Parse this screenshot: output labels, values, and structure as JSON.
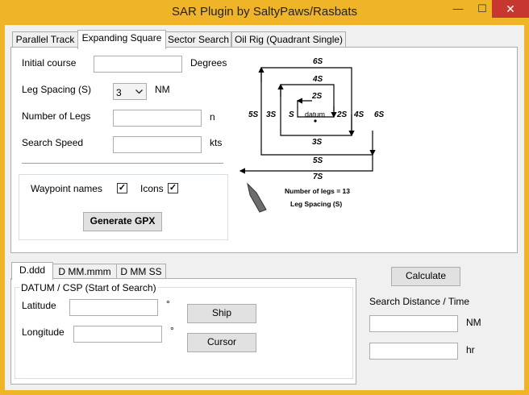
{
  "window": {
    "title": "SAR Plugin by SaltyPaws/Rasbats",
    "min_symbol": "—",
    "max_symbol": "☐",
    "close_symbol": "✕"
  },
  "tabs": [
    {
      "label": "Parallel Track"
    },
    {
      "label": "Expanding Square"
    },
    {
      "label": "Sector Search"
    },
    {
      "label": "Oil Rig (Quadrant Single)"
    }
  ],
  "expanding_square": {
    "initial_course_label": "Initial course",
    "initial_course_value": "",
    "initial_course_unit": "Degrees",
    "leg_spacing_label": "Leg Spacing (S)",
    "leg_spacing_value": "3",
    "leg_spacing_unit": "NM",
    "legs_label": "Number of Legs",
    "legs_value": "",
    "legs_unit": "n",
    "speed_label": "Search Speed",
    "speed_value": "",
    "speed_unit": "kts",
    "waypoint_names_label": "Waypoint names",
    "waypoint_names_checked": "✓",
    "icons_label": "Icons",
    "icons_checked": "✓",
    "generate_label": "Generate GPX"
  },
  "diagram": {
    "legs": [
      "6S",
      "4S",
      "2S",
      "S",
      "datum",
      "2S",
      "3S",
      "4S",
      "5S",
      "6S",
      "3S",
      "5S",
      "7S"
    ],
    "caption1": "Number of legs = 13",
    "caption2": "Leg Spacing (S)"
  },
  "coord_tabs": [
    {
      "label": "D.ddd"
    },
    {
      "label": "D MM.mmm"
    },
    {
      "label": "D MM SS"
    }
  ],
  "datum": {
    "group_label": "DATUM / CSP (Start of Search)",
    "latitude_label": "Latitude",
    "latitude_value": "",
    "latitude_unit": "°",
    "longitude_label": "Longitude",
    "longitude_value": "",
    "longitude_unit": "°",
    "ship_label": "Ship",
    "cursor_label": "Cursor"
  },
  "calc": {
    "calculate_label": "Calculate",
    "result_label": "Search Distance / Time",
    "distance_value": "",
    "distance_unit": "NM",
    "time_value": "",
    "time_unit": "hr"
  }
}
